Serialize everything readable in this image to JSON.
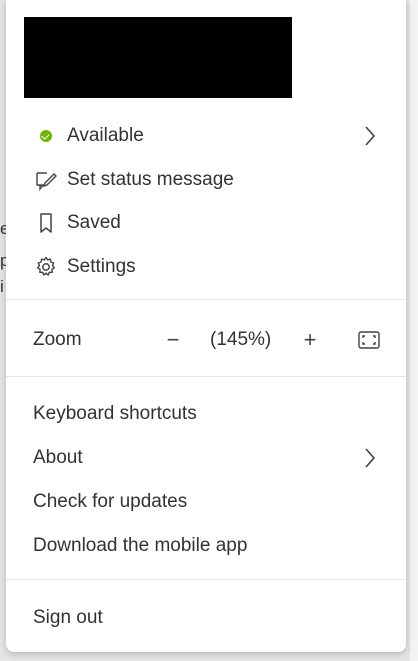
{
  "menu": {
    "status_items": [
      {
        "label": "Available"
      },
      {
        "label": "Set status message"
      },
      {
        "label": "Saved"
      },
      {
        "label": "Settings"
      }
    ],
    "zoom": {
      "label": "Zoom",
      "minus": "−",
      "value": "(145%)",
      "plus": "+"
    },
    "help_items": [
      {
        "label": "Keyboard shortcuts"
      },
      {
        "label": "About"
      },
      {
        "label": "Check for updates"
      },
      {
        "label": "Download the mobile app"
      }
    ],
    "sign_out": "Sign out"
  },
  "background_text": [
    "e",
    "p",
    "i"
  ],
  "colors": {
    "available": "#6bb700"
  },
  "icons": [
    "available-status-icon",
    "edit-status-icon",
    "bookmark-icon",
    "gear-icon",
    "chevron-right-icon",
    "fullscreen-icon"
  ]
}
